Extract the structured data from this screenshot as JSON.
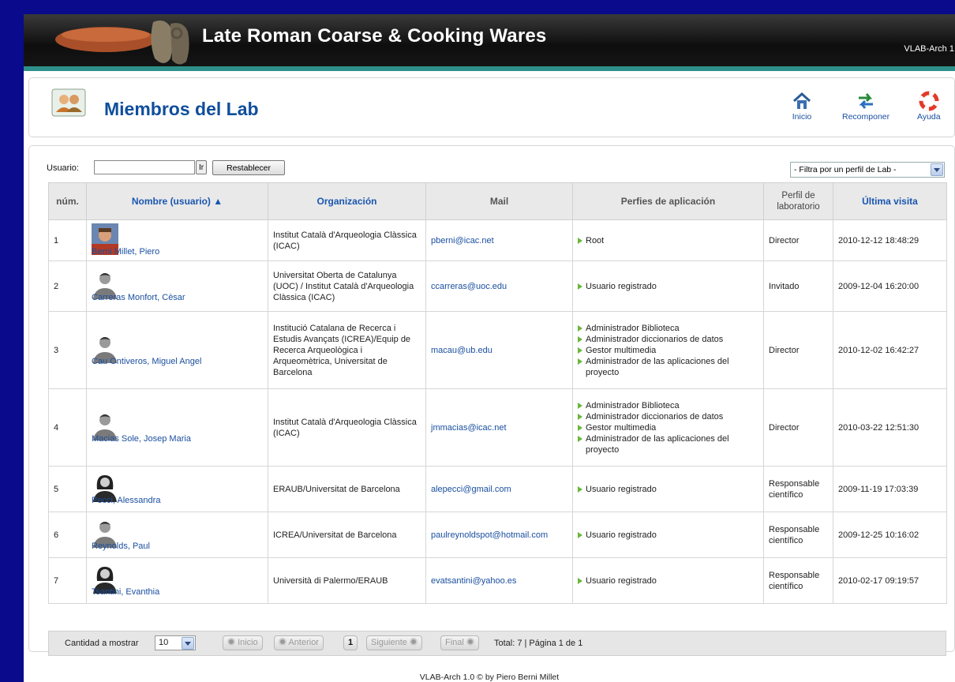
{
  "app": {
    "title": "Late Roman Coarse & Cooking Wares",
    "version": "VLAB-Arch 1."
  },
  "page": {
    "title": "Miembros del Lab"
  },
  "toolbar": {
    "inicio": "Inicio",
    "recomponer": "Recomponer",
    "ayuda": "Ayuda"
  },
  "filter": {
    "user_label": "Usuario:",
    "user_value": "",
    "go_label": "Ir",
    "reset_label": "Restablecer",
    "profile_filter": "- Filtra por un perfil de Lab -"
  },
  "table": {
    "headers": {
      "num": "núm.",
      "name": "Nombre (usuario) ▲",
      "org": "Organización",
      "mail": "Mail",
      "profiles": "Perfies de aplicación",
      "lab_profile": "Perfil de laboratorio",
      "last_visit": "Última visita"
    },
    "rows": [
      {
        "num": "1",
        "name": "Berni Millet, Piero",
        "org": "Institut Català d'Arqueologia Clàssica (ICAC)",
        "mail": "pberni@icac.net",
        "profiles": [
          "Root"
        ],
        "lab_profile": "Director",
        "last_visit": "2010-12-12 18:48:29",
        "avatar": "photo"
      },
      {
        "num": "2",
        "name": "Carreras Monfort, Cèsar",
        "org": "Universitat Oberta de Catalunya (UOC) / Institut Català d'Arqueologia Clàssica (ICAC)",
        "mail": "ccarreras@uoc.edu",
        "profiles": [
          "Usuario registrado"
        ],
        "lab_profile": "Invitado",
        "last_visit": "2009-12-04 16:20:00",
        "avatar": "male"
      },
      {
        "num": "3",
        "name": "Cau Ontiveros, Miguel Angel",
        "org": "Institució Catalana de Recerca i Estudis Avançats (ICREA)/Equip de Recerca Arqueològica i Arqueomètrica, Universitat de Barcelona",
        "mail": "macau@ub.edu",
        "profiles": [
          "Administrador Biblioteca",
          "Administrador diccionarios de datos",
          "Gestor multimedia",
          "Administrador de las aplicaciones del proyecto"
        ],
        "lab_profile": "Director",
        "last_visit": "2010-12-02 16:42:27",
        "avatar": "male"
      },
      {
        "num": "4",
        "name": "Macias Sole, Josep Maria",
        "org": "Institut Català d'Arqueologia Clàssica (ICAC)",
        "mail": "jmmacias@icac.net",
        "profiles": [
          "Administrador Biblioteca",
          "Administrador diccionarios de datos",
          "Gestor multimedia",
          "Administrador de las aplicaciones del proyecto"
        ],
        "lab_profile": "Director",
        "last_visit": "2010-03-22 12:51:30",
        "avatar": "male"
      },
      {
        "num": "5",
        "name": "Pecci, Alessandra",
        "org": "ERAUB/Universitat de Barcelona",
        "mail": "alepecci@gmail.com",
        "profiles": [
          "Usuario registrado"
        ],
        "lab_profile": "Responsable científico",
        "last_visit": "2009-11-19 17:03:39",
        "avatar": "female"
      },
      {
        "num": "6",
        "name": "Reynolds, Paul",
        "org": "ICREA/Universitat de Barcelona",
        "mail": "paulreynoldspot@hotmail.com",
        "profiles": [
          "Usuario registrado"
        ],
        "lab_profile": "Responsable científico",
        "last_visit": "2009-12-25 10:16:02",
        "avatar": "male"
      },
      {
        "num": "7",
        "name": "Tsantini, Evanthia",
        "org": "Università di Palermo/ERAUB",
        "mail": "evatsantini@yahoo.es",
        "profiles": [
          "Usuario registrado"
        ],
        "lab_profile": "Responsable científico",
        "last_visit": "2010-02-17 09:19:57",
        "avatar": "female"
      }
    ]
  },
  "pager": {
    "show_label": "Cantidad a mostrar",
    "page_size": "10",
    "first": "Inicio",
    "prev": "Anterior",
    "current": "1",
    "next": "Siguiente",
    "last": "Final",
    "total": "Total: 7 | Página 1 de 1"
  },
  "footer": {
    "text": "VLAB-Arch 1.0 ©  by Piero Berni Millet"
  }
}
